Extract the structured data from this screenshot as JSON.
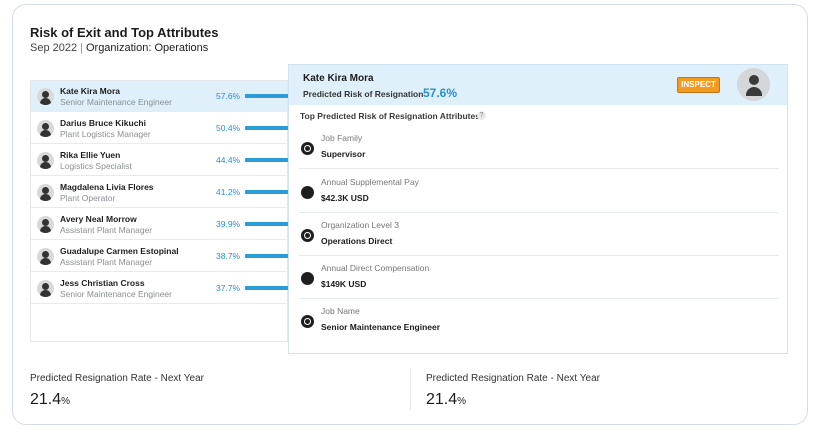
{
  "header": {
    "title": "Risk of Exit and Top Attributes",
    "period": "Sep 2022",
    "separator": "|",
    "org_label": "Organization: Operations"
  },
  "employees": [
    {
      "name": "Kate Kira Mora",
      "role": "Senior Maintenance Engineer",
      "risk": "57.6%",
      "risk_value": 57.6,
      "selected": true
    },
    {
      "name": "Darius Bruce Kikuchi",
      "role": "Plant Logistics Manager",
      "risk": "50.4%",
      "risk_value": 50.4,
      "selected": false
    },
    {
      "name": "Rika Ellie Yuen",
      "role": "Logistics Specialist",
      "risk": "44.4%",
      "risk_value": 44.4,
      "selected": false
    },
    {
      "name": "Magdalena Livia Flores",
      "role": "Plant Operator",
      "risk": "41.2%",
      "risk_value": 41.2,
      "selected": false
    },
    {
      "name": "Avery Neal Morrow",
      "role": "Assistant Plant Manager",
      "risk": "39.9%",
      "risk_value": 39.9,
      "selected": false
    },
    {
      "name": "Guadalupe Carmen Estopinal",
      "role": "Assistant Plant Manager",
      "risk": "38.7%",
      "risk_value": 38.7,
      "selected": false
    },
    {
      "name": "Jess Christian Cross",
      "role": "Senior Maintenance Engineer",
      "risk": "37.7%",
      "risk_value": 37.7,
      "selected": false
    }
  ],
  "detail": {
    "name": "Kate Kira Mora",
    "risk_label": "Predicted Risk of Resignation",
    "risk_value": "57.6%",
    "inspect_label": "INSPECT",
    "attributes_title": "Top Predicted Risk of Resignation Attributes",
    "help_glyph": "?",
    "attributes": [
      {
        "label": "Job Family",
        "value": "Supervisor",
        "icon": "triad-icon"
      },
      {
        "label": "Annual Supplemental Pay",
        "value": "$42.3K USD",
        "icon": "dot-icon"
      },
      {
        "label": "Organization Level 3",
        "value": "Operations Direct",
        "icon": "triad-icon"
      },
      {
        "label": "Annual Direct Compensation",
        "value": "$149K USD",
        "icon": "dot-icon"
      },
      {
        "label": "Job Name",
        "value": "Senior Maintenance Engineer",
        "icon": "triad-icon"
      }
    ]
  },
  "metrics": [
    {
      "label": "Predicted Resignation Rate - Next Year",
      "value": "21.4",
      "unit": "%"
    },
    {
      "label": "Predicted Resignation Rate - Next Year",
      "value": "21.4",
      "unit": "%"
    }
  ],
  "colors": {
    "accent": "#2b9cd8",
    "selected_row": "#dff0fb",
    "inspect_button": "#f29b1e"
  }
}
